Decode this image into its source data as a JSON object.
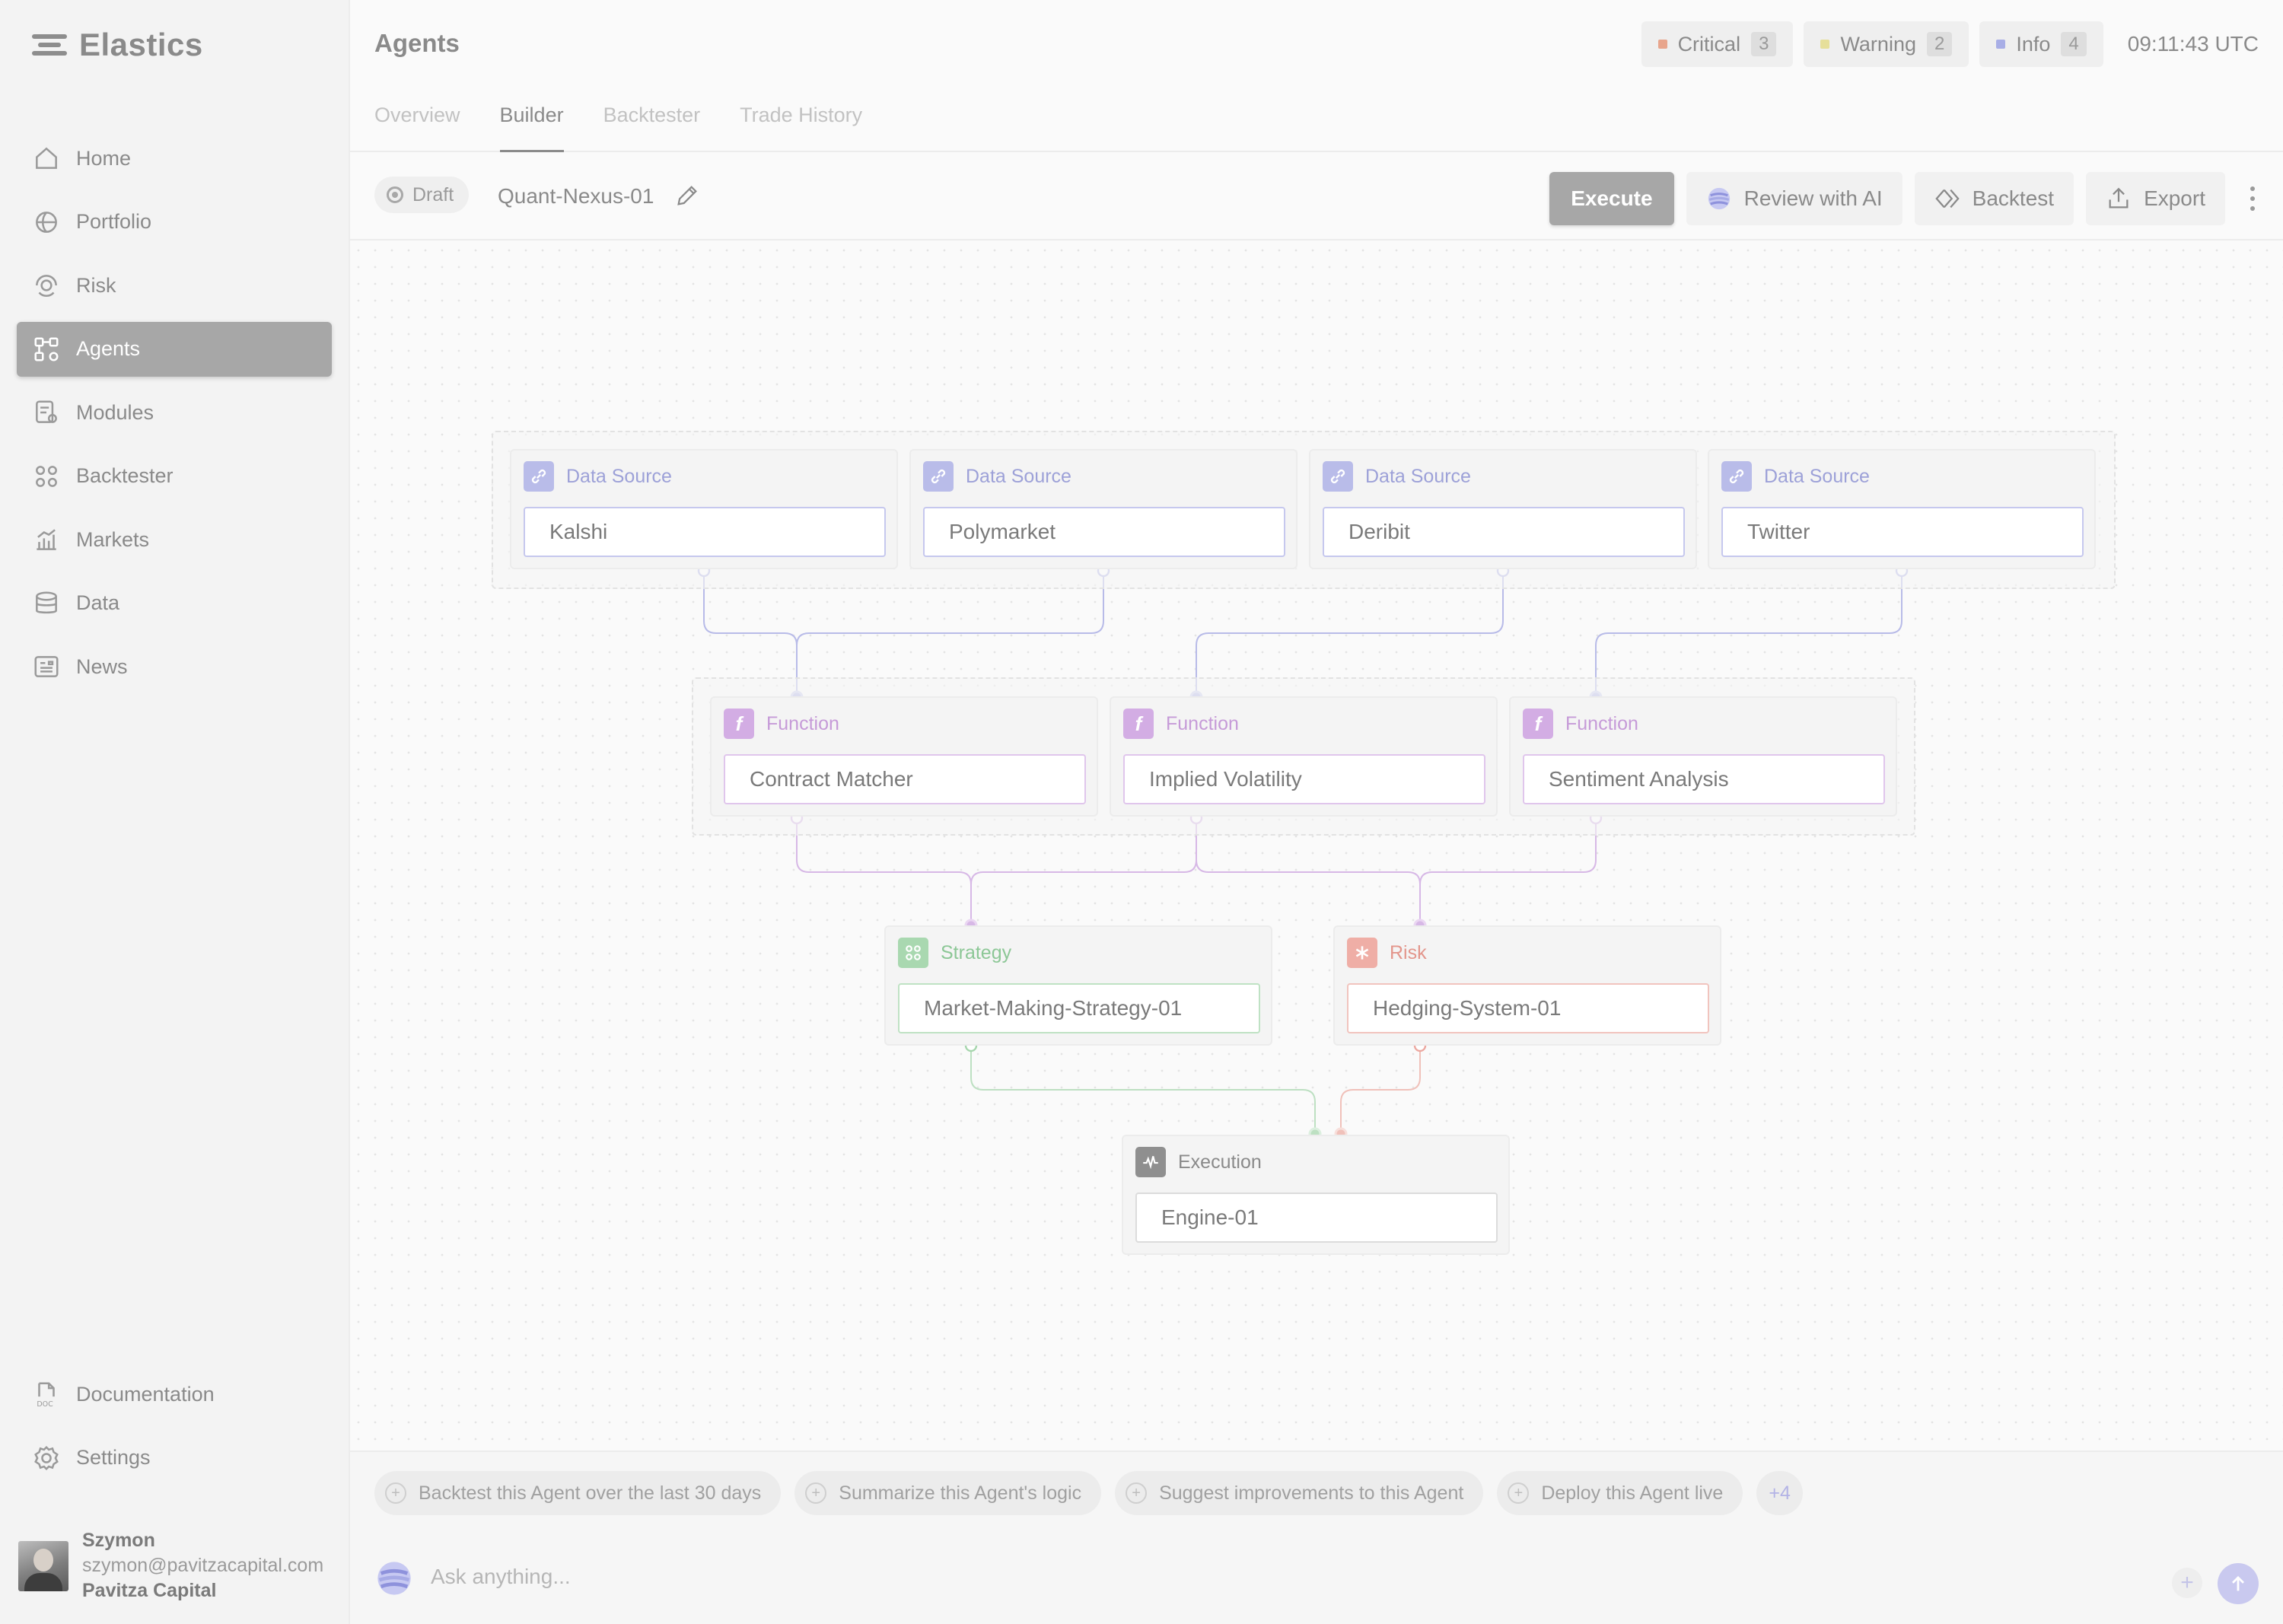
{
  "app": {
    "name": "Elastics"
  },
  "sidebar": {
    "items": [
      {
        "label": "Home",
        "icon": "home-icon"
      },
      {
        "label": "Portfolio",
        "icon": "globe-icon"
      },
      {
        "label": "Risk",
        "icon": "risk-icon"
      },
      {
        "label": "Agents",
        "icon": "agents-icon",
        "active": true
      },
      {
        "label": "Modules",
        "icon": "modules-icon"
      },
      {
        "label": "Backtester",
        "icon": "backtester-icon"
      },
      {
        "label": "Markets",
        "icon": "markets-icon"
      },
      {
        "label": "Data",
        "icon": "data-icon"
      },
      {
        "label": "News",
        "icon": "news-icon"
      }
    ],
    "bottom": [
      {
        "label": "Documentation",
        "icon": "doc-icon"
      },
      {
        "label": "Settings",
        "icon": "gear-icon"
      }
    ],
    "user": {
      "name": "Szymon",
      "email": "szymon@pavitzacapital.com",
      "org": "Pavitza Capital"
    }
  },
  "header": {
    "title": "Agents",
    "alerts": [
      {
        "label": "Critical",
        "count": "3",
        "color": "#e8a58c"
      },
      {
        "label": "Warning",
        "count": "2",
        "color": "#e6df9a"
      },
      {
        "label": "Info",
        "count": "4",
        "color": "#a8aee6"
      }
    ],
    "clock": "09:11:43 UTC",
    "tabs": [
      {
        "label": "Overview",
        "active": false
      },
      {
        "label": "Builder",
        "active": true
      },
      {
        "label": "Backtester",
        "active": false
      },
      {
        "label": "Trade History",
        "active": false
      }
    ]
  },
  "toolbar": {
    "status": "Draft",
    "agent_name": "Quant-Nexus-01",
    "execute_label": "Execute",
    "review_label": "Review with AI",
    "backtest_label": "Backtest",
    "export_label": "Export"
  },
  "graph": {
    "data_sources": [
      {
        "type": "Data Source",
        "value": "Kalshi"
      },
      {
        "type": "Data Source",
        "value": "Polymarket"
      },
      {
        "type": "Data Source",
        "value": "Deribit"
      },
      {
        "type": "Data Source",
        "value": "Twitter"
      }
    ],
    "functions": [
      {
        "type": "Function",
        "value": "Contract Matcher"
      },
      {
        "type": "Function",
        "value": "Implied Volatility"
      },
      {
        "type": "Function",
        "value": "Sentiment Analysis"
      }
    ],
    "strategy": {
      "type": "Strategy",
      "value": "Market-Making-Strategy-01"
    },
    "risk": {
      "type": "Risk",
      "value": "Hedging-System-01"
    },
    "execution": {
      "type": "Execution",
      "value": "Engine-01"
    },
    "colors": {
      "data_source": "#a5a9e0",
      "function": "#cfa7e0",
      "strategy": "#9fd3a6",
      "risk": "#eca8a0",
      "execution": "#8f8f8f"
    }
  },
  "suggestions": [
    "Backtest this Agent over the last 30 days",
    "Summarize this Agent's logic",
    "Suggest improvements to this Agent",
    "Deploy this Agent live"
  ],
  "suggestions_more": "+4",
  "ask": {
    "placeholder": "Ask anything..."
  }
}
